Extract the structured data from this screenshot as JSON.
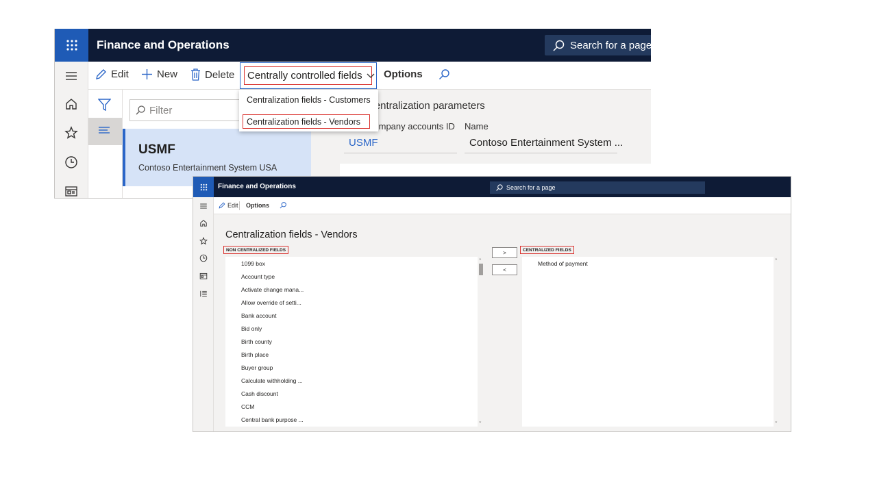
{
  "back_window": {
    "app_title": "Finance and Operations",
    "search_placeholder": "Search for a page",
    "actions": {
      "edit": "Edit",
      "new": "New",
      "delete": "Delete",
      "dropdown": "Centrally controlled fields",
      "options": "Options"
    },
    "dropdown_menu": [
      "Centralization fields - Customers",
      "Centralization fields - Vendors"
    ],
    "filter_placeholder": "Filter",
    "list_item": {
      "id": "USMF",
      "name": "Contoso Entertainment System USA"
    },
    "detail": {
      "title": "Centralization parameters",
      "col1_label": "Company accounts ID",
      "col2_label": "Name",
      "col1_value": "USMF",
      "col2_value": "Contoso Entertainment System ..."
    }
  },
  "front_window": {
    "app_title": "Finance and Operations",
    "search_placeholder": "Search for a page",
    "actions": {
      "edit": "Edit",
      "options": "Options"
    },
    "page_title": "Centralization fields - Vendors",
    "non_centralized_header": "NON CENTRALIZED FIELDS",
    "centralized_header": "CENTRALIZED FIELDS",
    "move_right": ">",
    "move_left": "<",
    "non_centralized_fields": [
      "1099 box",
      "Account type",
      "Activate change mana...",
      "Allow override of setti...",
      "Bank account",
      "Bid only",
      "Birth county",
      "Birth place",
      "Buyer group",
      "Calculate withholding ...",
      "Cash discount",
      "CCM",
      "Central bank purpose ..."
    ],
    "centralized_fields": [
      "Method of payment"
    ]
  },
  "colors": {
    "navy": "#0e1b36",
    "waffle_blue": "#1f5bb6",
    "highlight_red": "#d9302c",
    "accent_blue": "#2b66c8"
  }
}
